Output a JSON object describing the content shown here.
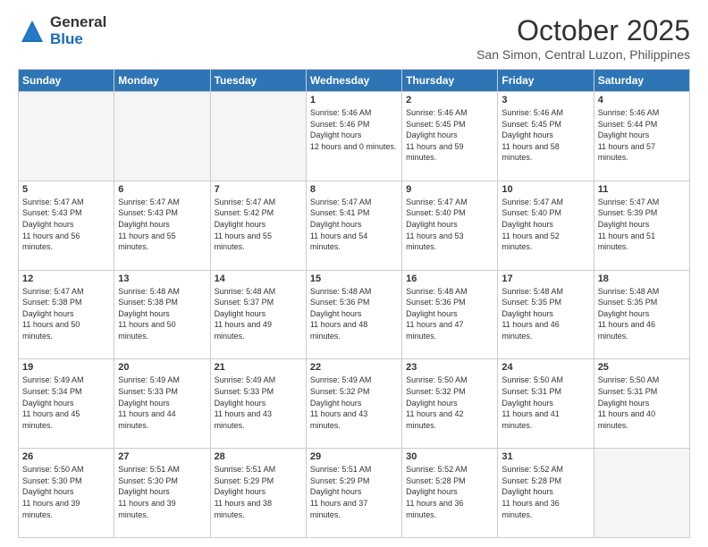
{
  "header": {
    "logo_general": "General",
    "logo_blue": "Blue",
    "month_title": "October 2025",
    "location": "San Simon, Central Luzon, Philippines"
  },
  "calendar": {
    "days_of_week": [
      "Sunday",
      "Monday",
      "Tuesday",
      "Wednesday",
      "Thursday",
      "Friday",
      "Saturday"
    ],
    "weeks": [
      [
        {
          "day": "",
          "empty": true
        },
        {
          "day": "",
          "empty": true
        },
        {
          "day": "",
          "empty": true
        },
        {
          "day": "1",
          "sunrise": "5:46 AM",
          "sunset": "5:46 PM",
          "daylight": "12 hours and 0 minutes."
        },
        {
          "day": "2",
          "sunrise": "5:46 AM",
          "sunset": "5:45 PM",
          "daylight": "11 hours and 59 minutes."
        },
        {
          "day": "3",
          "sunrise": "5:46 AM",
          "sunset": "5:45 PM",
          "daylight": "11 hours and 58 minutes."
        },
        {
          "day": "4",
          "sunrise": "5:46 AM",
          "sunset": "5:44 PM",
          "daylight": "11 hours and 57 minutes."
        }
      ],
      [
        {
          "day": "5",
          "sunrise": "5:47 AM",
          "sunset": "5:43 PM",
          "daylight": "11 hours and 56 minutes."
        },
        {
          "day": "6",
          "sunrise": "5:47 AM",
          "sunset": "5:43 PM",
          "daylight": "11 hours and 55 minutes."
        },
        {
          "day": "7",
          "sunrise": "5:47 AM",
          "sunset": "5:42 PM",
          "daylight": "11 hours and 55 minutes."
        },
        {
          "day": "8",
          "sunrise": "5:47 AM",
          "sunset": "5:41 PM",
          "daylight": "11 hours and 54 minutes."
        },
        {
          "day": "9",
          "sunrise": "5:47 AM",
          "sunset": "5:40 PM",
          "daylight": "11 hours and 53 minutes."
        },
        {
          "day": "10",
          "sunrise": "5:47 AM",
          "sunset": "5:40 PM",
          "daylight": "11 hours and 52 minutes."
        },
        {
          "day": "11",
          "sunrise": "5:47 AM",
          "sunset": "5:39 PM",
          "daylight": "11 hours and 51 minutes."
        }
      ],
      [
        {
          "day": "12",
          "sunrise": "5:47 AM",
          "sunset": "5:38 PM",
          "daylight": "11 hours and 50 minutes."
        },
        {
          "day": "13",
          "sunrise": "5:48 AM",
          "sunset": "5:38 PM",
          "daylight": "11 hours and 50 minutes."
        },
        {
          "day": "14",
          "sunrise": "5:48 AM",
          "sunset": "5:37 PM",
          "daylight": "11 hours and 49 minutes."
        },
        {
          "day": "15",
          "sunrise": "5:48 AM",
          "sunset": "5:36 PM",
          "daylight": "11 hours and 48 minutes."
        },
        {
          "day": "16",
          "sunrise": "5:48 AM",
          "sunset": "5:36 PM",
          "daylight": "11 hours and 47 minutes."
        },
        {
          "day": "17",
          "sunrise": "5:48 AM",
          "sunset": "5:35 PM",
          "daylight": "11 hours and 46 minutes."
        },
        {
          "day": "18",
          "sunrise": "5:48 AM",
          "sunset": "5:35 PM",
          "daylight": "11 hours and 46 minutes."
        }
      ],
      [
        {
          "day": "19",
          "sunrise": "5:49 AM",
          "sunset": "5:34 PM",
          "daylight": "11 hours and 45 minutes."
        },
        {
          "day": "20",
          "sunrise": "5:49 AM",
          "sunset": "5:33 PM",
          "daylight": "11 hours and 44 minutes."
        },
        {
          "day": "21",
          "sunrise": "5:49 AM",
          "sunset": "5:33 PM",
          "daylight": "11 hours and 43 minutes."
        },
        {
          "day": "22",
          "sunrise": "5:49 AM",
          "sunset": "5:32 PM",
          "daylight": "11 hours and 43 minutes."
        },
        {
          "day": "23",
          "sunrise": "5:50 AM",
          "sunset": "5:32 PM",
          "daylight": "11 hours and 42 minutes."
        },
        {
          "day": "24",
          "sunrise": "5:50 AM",
          "sunset": "5:31 PM",
          "daylight": "11 hours and 41 minutes."
        },
        {
          "day": "25",
          "sunrise": "5:50 AM",
          "sunset": "5:31 PM",
          "daylight": "11 hours and 40 minutes."
        }
      ],
      [
        {
          "day": "26",
          "sunrise": "5:50 AM",
          "sunset": "5:30 PM",
          "daylight": "11 hours and 39 minutes."
        },
        {
          "day": "27",
          "sunrise": "5:51 AM",
          "sunset": "5:30 PM",
          "daylight": "11 hours and 39 minutes."
        },
        {
          "day": "28",
          "sunrise": "5:51 AM",
          "sunset": "5:29 PM",
          "daylight": "11 hours and 38 minutes."
        },
        {
          "day": "29",
          "sunrise": "5:51 AM",
          "sunset": "5:29 PM",
          "daylight": "11 hours and 37 minutes."
        },
        {
          "day": "30",
          "sunrise": "5:52 AM",
          "sunset": "5:28 PM",
          "daylight": "11 hours and 36 minutes."
        },
        {
          "day": "31",
          "sunrise": "5:52 AM",
          "sunset": "5:28 PM",
          "daylight": "11 hours and 36 minutes."
        },
        {
          "day": "",
          "empty": true
        }
      ]
    ]
  }
}
